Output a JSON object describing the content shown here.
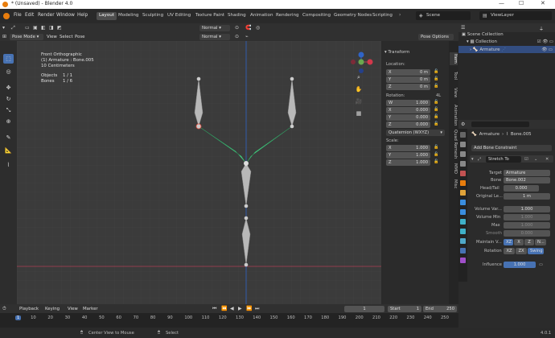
{
  "window": {
    "title": "* (Unsaved) - Blender 4.0",
    "minimize": "—",
    "maximize": "☐",
    "close": "✕"
  },
  "menu": [
    "File",
    "Edit",
    "Render",
    "Window",
    "Help"
  ],
  "workspaces": [
    "Layout",
    "Modeling",
    "Sculpting",
    "UV Editing",
    "Texture Paint",
    "Shading",
    "Animation",
    "Rendering",
    "Compositing",
    "Geometry Nodes",
    "Scripting"
  ],
  "scene": {
    "name": "Scene",
    "view_layer": "ViewLayer"
  },
  "header1": {
    "mode": "Pose Mode",
    "view": "View",
    "select": "Select",
    "pose": "Pose",
    "orientation": "Normal"
  },
  "header2": {
    "mode": "Pose Mode",
    "view": "View",
    "select": "Select",
    "pose": "Pose",
    "orientation": "Normal",
    "pose_options": "Pose Options"
  },
  "overlay_text": {
    "view": "Front Orthographic",
    "object": "(1) Armature : Bone.005",
    "scale": "10 Centimeters",
    "objects_label": "Objects",
    "objects_value": "1 / 1",
    "bones_label": "Bones",
    "bones_value": "1 / 6"
  },
  "nav_gizmo": {
    "z": "Z",
    "x": "X",
    "y": "Y"
  },
  "transform": {
    "title": "Transform",
    "location_label": "Location:",
    "location": [
      {
        "axis": "X",
        "value": "0 m"
      },
      {
        "axis": "Y",
        "value": "0 m"
      },
      {
        "axis": "Z",
        "value": "0 m"
      }
    ],
    "rotation_label": "Rotation:",
    "rotation_mode_tag": "4L",
    "rotation": [
      {
        "axis": "W",
        "value": "1.000"
      },
      {
        "axis": "X",
        "value": "0.000"
      },
      {
        "axis": "Y",
        "value": "0.000"
      },
      {
        "axis": "Z",
        "value": "0.000"
      }
    ],
    "rotation_mode": "Quaternion (WXYZ)",
    "scale_label": "Scale:",
    "scale": [
      {
        "axis": "X",
        "value": "1.000"
      },
      {
        "axis": "Y",
        "value": "1.000"
      },
      {
        "axis": "Z",
        "value": "1.000"
      }
    ]
  },
  "ntabs": [
    "Item",
    "Tool",
    "View",
    "Animation",
    "Quad Remesh",
    "MMD",
    "Misc"
  ],
  "outliner": {
    "scene_collection": "Scene Collection",
    "collection": "Collection",
    "armature": "Armature"
  },
  "properties": {
    "breadcrumb_object": "Armature",
    "breadcrumb_bone": "Bone.005",
    "add_constraint": "Add Bone Constraint",
    "constraint_name": "Stretch To",
    "target_label": "Target",
    "target_value": "Armature",
    "bone_label": "Bone",
    "bone_value": "Bone.002",
    "headtail_label": "Head/Tail",
    "headtail_value": "0.000",
    "origlen_label": "Original Le...",
    "origlen_value": "1 m",
    "volvar_label": "Volume Var...",
    "volvar_value": "1.000",
    "volmin_label": "Volume Min",
    "volmin_value": "1.000",
    "max_label": "Max",
    "max_value": "1.000",
    "smooth_label": "Smooth",
    "smooth_value": "0.000",
    "maintain_label": "Maintain V...",
    "maintain_opts": [
      "XZ",
      "X",
      "Z",
      "N..."
    ],
    "rotation_label": "Rotation",
    "rotation_opts": [
      "XZ",
      "ZX",
      "Swing"
    ],
    "influence_label": "Influence",
    "influence_value": "1.000"
  },
  "timeline": {
    "playback": "Playback",
    "keying": "Keying",
    "view": "View",
    "marker": "Marker",
    "current_frame": "1",
    "start_label": "Start",
    "start_value": "1",
    "end_label": "End",
    "end_value": "250",
    "ruler": [
      "1",
      "10",
      "20",
      "30",
      "40",
      "50",
      "60",
      "70",
      "80",
      "90",
      "100",
      "110",
      "120",
      "130",
      "140",
      "150",
      "160",
      "170",
      "180",
      "190",
      "200",
      "210",
      "220",
      "230",
      "240",
      "250"
    ],
    "frame_badge": "1"
  },
  "status": {
    "center": "Center View to Mouse",
    "select": "Select",
    "version": "4.0.1"
  },
  "colors": {
    "accent": "#4772b3",
    "bone_selected": "#4fd48a",
    "bone": "#b8b8b8",
    "x_axis": "#b04155",
    "z_axis": "#2f64c7"
  }
}
